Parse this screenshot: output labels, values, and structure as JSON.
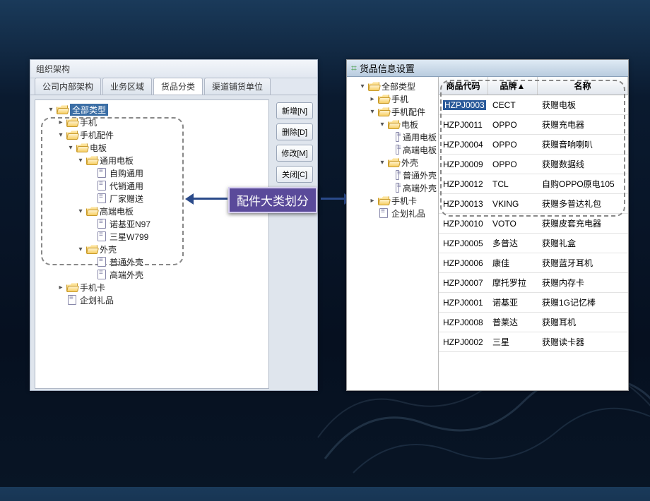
{
  "left_panel": {
    "title": "组织架构",
    "tabs": [
      "公司内部架构",
      "业务区域",
      "货品分类",
      "渠道铺货单位"
    ],
    "active_tab_index": 2,
    "buttons": {
      "add": "新增[N]",
      "delete": "删除[D]",
      "modify": "修改[M]",
      "close": "关闭[C]"
    },
    "tree": [
      {
        "level": 1,
        "type": "folder-open",
        "expander": "▾",
        "label": "全部类型",
        "selected": true
      },
      {
        "level": 2,
        "type": "folder-open",
        "expander": "▸",
        "label": "手机"
      },
      {
        "level": 2,
        "type": "folder-open",
        "expander": "▾",
        "label": "手机配件"
      },
      {
        "level": 3,
        "type": "folder-open",
        "expander": "▾",
        "label": "电板"
      },
      {
        "level": 4,
        "type": "folder-open",
        "expander": "▾",
        "label": "通用电板"
      },
      {
        "level": 5,
        "type": "doc",
        "expander": "",
        "label": "自购通用"
      },
      {
        "level": 5,
        "type": "doc",
        "expander": "",
        "label": "代销通用"
      },
      {
        "level": 5,
        "type": "doc",
        "expander": "",
        "label": "厂家赠送"
      },
      {
        "level": 4,
        "type": "folder-open",
        "expander": "▾",
        "label": "高端电板"
      },
      {
        "level": 5,
        "type": "doc",
        "expander": "",
        "label": "诺基亚N97"
      },
      {
        "level": 5,
        "type": "doc",
        "expander": "",
        "label": "三星W799"
      },
      {
        "level": 4,
        "type": "folder-open",
        "expander": "▾",
        "label": "外壳"
      },
      {
        "level": 5,
        "type": "doc",
        "expander": "",
        "label": "普通外壳"
      },
      {
        "level": 5,
        "type": "doc",
        "expander": "",
        "label": "高端外壳"
      },
      {
        "level": 2,
        "type": "folder-open",
        "expander": "▸",
        "label": "手机卡"
      },
      {
        "level": 2,
        "type": "doc",
        "expander": "",
        "label": "企划礼品"
      }
    ]
  },
  "center_label": "配件大类划分",
  "right_panel": {
    "title": "货品信息设置",
    "tree": [
      {
        "level": 1,
        "type": "folder-open",
        "expander": "▾",
        "label": "全部类型"
      },
      {
        "level": 2,
        "type": "folder-open",
        "expander": "▸",
        "label": "手机"
      },
      {
        "level": 2,
        "type": "folder-open",
        "expander": "▾",
        "label": "手机配件"
      },
      {
        "level": 3,
        "type": "folder-open",
        "expander": "▾",
        "label": "电板"
      },
      {
        "level": 4,
        "type": "doc",
        "expander": "",
        "label": "通用电板"
      },
      {
        "level": 4,
        "type": "doc",
        "expander": "",
        "label": "高端电板"
      },
      {
        "level": 3,
        "type": "folder-open",
        "expander": "▾",
        "label": "外壳"
      },
      {
        "level": 4,
        "type": "doc",
        "expander": "",
        "label": "普通外壳"
      },
      {
        "level": 4,
        "type": "doc",
        "expander": "",
        "label": "高端外壳"
      },
      {
        "level": 2,
        "type": "folder-open",
        "expander": "▸",
        "label": "手机卡"
      },
      {
        "level": 2,
        "type": "doc",
        "expander": "",
        "label": "企划礼品"
      }
    ],
    "grid": {
      "headers": {
        "code": "商品代码",
        "brand": "品牌▲",
        "name": "名称"
      },
      "rows": [
        {
          "code": "HZPJ0003",
          "brand": "CECT",
          "name": "获赠电板",
          "selected": true
        },
        {
          "code": "HZPJ0011",
          "brand": "OPPO",
          "name": "获赠充电器"
        },
        {
          "code": "HZPJ0004",
          "brand": "OPPO",
          "name": "获赠音响喇叭"
        },
        {
          "code": "HZPJ0009",
          "brand": "OPPO",
          "name": "获赠数据线"
        },
        {
          "code": "HZPJ0012",
          "brand": "TCL",
          "name": "自购OPPO原电105"
        },
        {
          "code": "HZPJ0013",
          "brand": "VKING",
          "name": "获赠多普达礼包"
        },
        {
          "code": "HZPJ0010",
          "brand": "VOTO",
          "name": "获赠皮套充电器"
        },
        {
          "code": "HZPJ0005",
          "brand": "多普达",
          "name": "获赠礼盒"
        },
        {
          "code": "HZPJ0006",
          "brand": "康佳",
          "name": "获赠蓝牙耳机"
        },
        {
          "code": "HZPJ0007",
          "brand": "摩托罗拉",
          "name": "获赠内存卡"
        },
        {
          "code": "HZPJ0001",
          "brand": "诺基亚",
          "name": "获赠1G记忆棒"
        },
        {
          "code": "HZPJ0008",
          "brand": "普莱达",
          "name": "获赠耳机"
        },
        {
          "code": "HZPJ0002",
          "brand": "三星",
          "name": "获赠读卡器"
        }
      ]
    }
  }
}
